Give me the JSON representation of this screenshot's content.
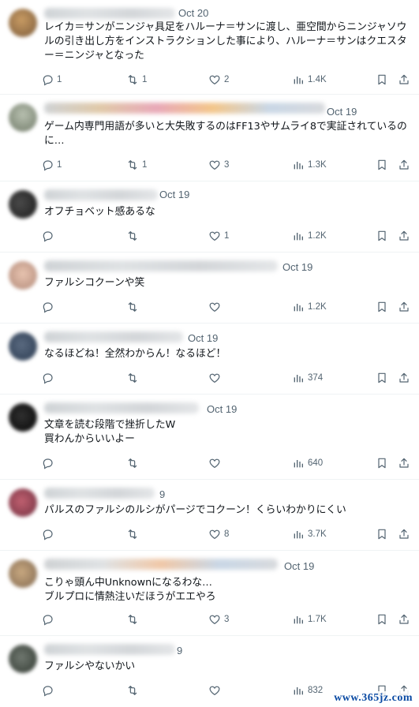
{
  "tweets": [
    {
      "date_meta": "Oct 20",
      "text": "レイカ＝サンがニンジャ具足をハルーナ＝サンに渡し、亜空間からニンジャソウルの引き出し方をインストラクションした事により、ハルーナ＝サンはクエスター＝ニンジャとなった",
      "replies": "1",
      "retweets": "1",
      "likes": "2",
      "views": "1.4K"
    },
    {
      "date_meta": "Oct 19",
      "text": "ゲーム内専門用語が多いと大失敗するのはFF13やサムライ8で実証されているのに…",
      "replies": "1",
      "retweets": "1",
      "likes": "3",
      "views": "1.3K"
    },
    {
      "date_meta": "Oct 19",
      "text": "オフチョベット感あるな",
      "replies": "",
      "retweets": "",
      "likes": "1",
      "views": "1.2K"
    },
    {
      "date_meta": "Oct 19",
      "text": "ファルシコクーンや笑",
      "replies": "",
      "retweets": "",
      "likes": "",
      "views": "1.2K"
    },
    {
      "date_meta": "Oct 19",
      "text": "なるほどね！全然わからん！なるほど！",
      "replies": "",
      "retweets": "",
      "likes": "",
      "views": "374"
    },
    {
      "date_meta": "Oct 19",
      "text": "文章を読む段階で挫折したW\n買わんからいいよー",
      "replies": "",
      "retweets": "",
      "likes": "",
      "views": "640"
    },
    {
      "date_meta": "9",
      "text": "パルスのファルシのルシがパージでコクーン！くらいわかりにくい",
      "replies": "",
      "retweets": "",
      "likes": "8",
      "views": "3.7K"
    },
    {
      "date_meta": "Oct 19",
      "text": "こりゃ頭ん中Unknownになるわな…\nブルプロに情熱注いだほうがエエやろ",
      "replies": "",
      "retweets": "",
      "likes": "3",
      "views": "1.7K"
    },
    {
      "date_meta": "9",
      "text": "ファルシやないかい",
      "replies": "",
      "retweets": "",
      "likes": "",
      "views": "832"
    }
  ],
  "watermark": "www.365jz.com"
}
